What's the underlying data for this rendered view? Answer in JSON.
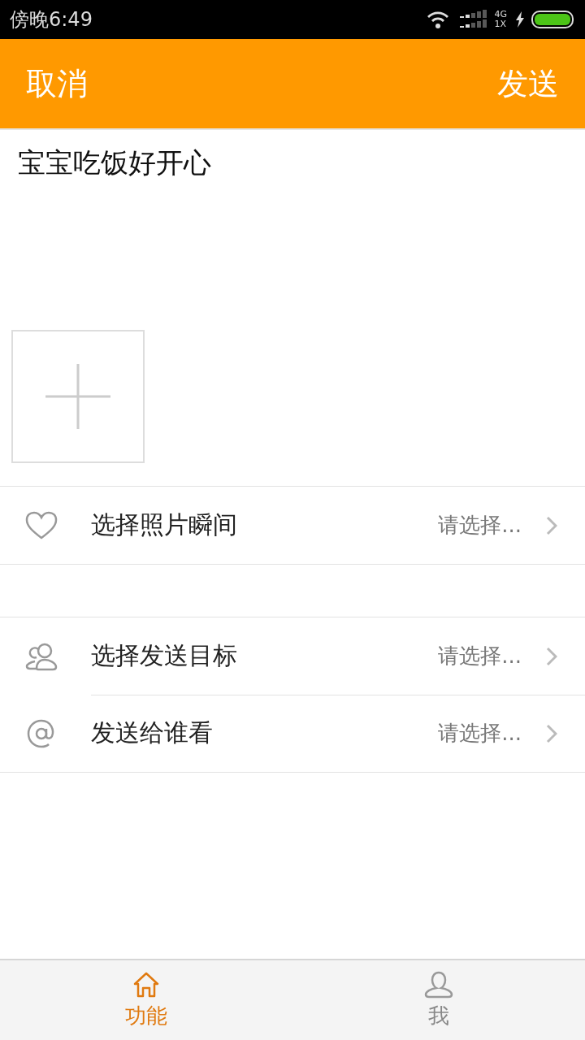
{
  "status_bar": {
    "time": "傍晚6:49",
    "network": "4G",
    "network2": "1X"
  },
  "header": {
    "cancel": "取消",
    "send": "发送"
  },
  "post": {
    "value": "宝宝吃饭好开心"
  },
  "sections": [
    {
      "rows": [
        {
          "kind": "heart",
          "label": "选择照片瞬间",
          "value": "请选择..."
        }
      ]
    },
    {
      "rows": [
        {
          "kind": "group",
          "label": "选择发送目标",
          "value": "请选择..."
        },
        {
          "kind": "at",
          "label": "发送给谁看",
          "value": "请选择..."
        }
      ]
    }
  ],
  "tabs": [
    {
      "kind": "home",
      "label": "功能",
      "selected": true
    },
    {
      "kind": "user",
      "label": "我",
      "selected": false
    }
  ]
}
